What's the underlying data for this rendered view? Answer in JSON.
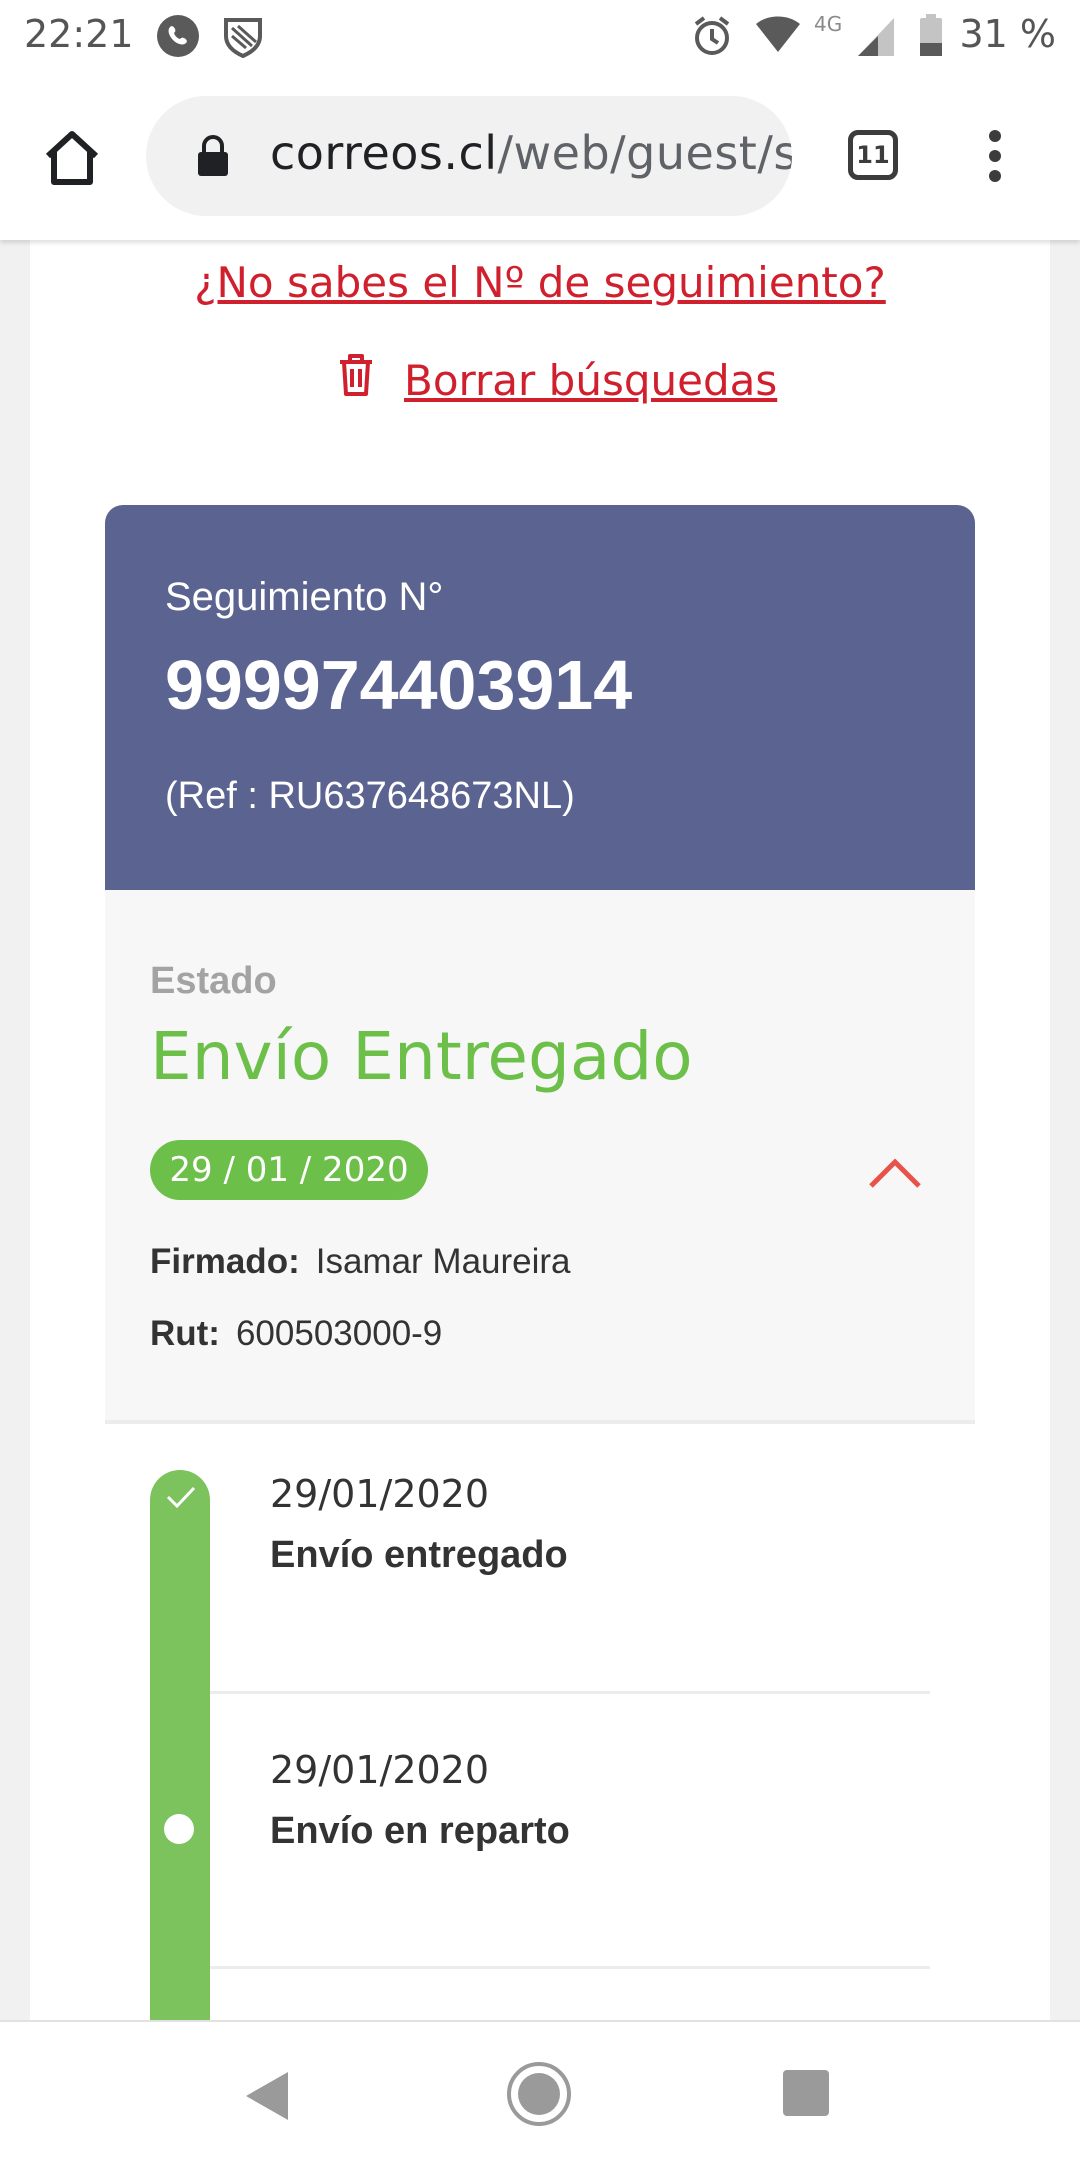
{
  "status_bar": {
    "time": "22:21",
    "network": "4G",
    "battery": "31 %"
  },
  "browser": {
    "url_domain": "correos.cl",
    "url_path": "/web/guest/s",
    "tab_count": "11"
  },
  "page": {
    "link_no_tracking": "¿No sabes el Nº de seguimiento?",
    "link_clear_searches": "Borrar búsquedas",
    "tracking_label": "Seguimiento N°",
    "tracking_number": "999974403914",
    "reference": "(Ref : RU637648673NL)",
    "status_label": "Estado",
    "status_value": "Envío Entregado",
    "status_date": "29 / 01 / 2020",
    "signed_label": "Firmado:",
    "signed_value": "Isamar Maureira",
    "rut_label": "Rut:",
    "rut_value": "600503000-9",
    "events": [
      {
        "date": "29/01/2020",
        "title": "Envío entregado"
      },
      {
        "date": "29/01/2020",
        "title": "Envío en reparto"
      }
    ]
  },
  "colors": {
    "accent_red": "#d0202e",
    "card_header": "#5b6391",
    "status_green": "#6cc04a"
  }
}
